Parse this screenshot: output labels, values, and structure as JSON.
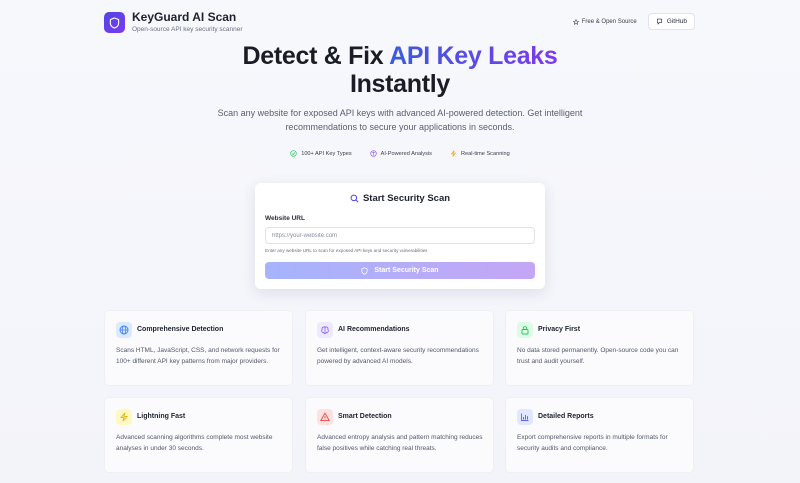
{
  "header": {
    "brand_title": "KeyGuard AI Scan",
    "brand_subtitle": "Open-source API key security scanner",
    "oss_badge": "Free & Open Source",
    "github_label": "GitHub"
  },
  "hero": {
    "title_part1": "Detect & Fix ",
    "title_accent": "API Key Leaks",
    "title_line2": "Instantly",
    "description": "Scan any website for exposed API keys with advanced AI-powered detection. Get intelligent recommendations to secure your applications in seconds.",
    "pills": [
      {
        "label": "100+ API Key Types",
        "icon": "check-circle-icon",
        "color": "#22c55e"
      },
      {
        "label": "AI-Powered Analysis",
        "icon": "brain-icon",
        "color": "#8b5cf6"
      },
      {
        "label": "Real-time Scanning",
        "icon": "bolt-icon",
        "color": "#f59e0b"
      }
    ]
  },
  "scan": {
    "title": "Start Security Scan",
    "url_label": "Website URL",
    "url_placeholder": "https://your-website.com",
    "url_value": "",
    "help_text": "Enter any website URL to scan for exposed API keys and security vulnerabilities",
    "button_label": "Start Security Scan"
  },
  "features": [
    {
      "title": "Comprehensive Detection",
      "desc": "Scans HTML, JavaScript, CSS, and network requests for 100+ different API key patterns from major providers.",
      "icon": "globe-icon",
      "color": "#3b82f6"
    },
    {
      "title": "AI Recommendations",
      "desc": "Get intelligent, context-aware security recommendations powered by advanced AI models.",
      "icon": "brain-icon",
      "color": "#8b5cf6"
    },
    {
      "title": "Privacy First",
      "desc": "No data stored permanently. Open-source code you can trust and audit yourself.",
      "icon": "lock-icon",
      "color": "#22c55e"
    },
    {
      "title": "Lightning Fast",
      "desc": "Advanced scanning algorithms complete most website analyses in under 30 seconds.",
      "icon": "bolt-icon",
      "color": "#eab308"
    },
    {
      "title": "Smart Detection",
      "desc": "Advanced entropy analysis and pattern matching reduces false positives while catching real threats.",
      "icon": "warning-icon",
      "color": "#ef4444"
    },
    {
      "title": "Detailed Reports",
      "desc": "Export comprehensive reports in multiple formats for security audits and compliance.",
      "icon": "bar-chart-icon",
      "color": "#6366f1"
    }
  ]
}
